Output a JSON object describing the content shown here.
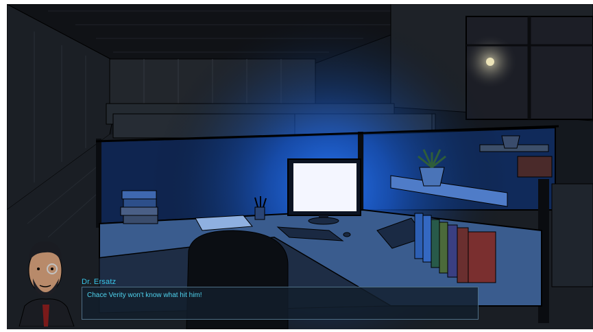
{
  "dialog": {
    "speaker": "Dr. Ersatz",
    "line": "Chace Verity won't know what hit him!"
  },
  "scene": {
    "setting": "office-cubicles-night",
    "glow_color": "#2a7cff",
    "monitor_color": "#f4f6ff"
  },
  "colors": {
    "speaker_name": "#39c6e8",
    "dialog_text": "#4fd3ee",
    "dialog_border": "#4f6f86"
  },
  "icons": [
    "character-portrait-icon",
    "moon-icon"
  ]
}
